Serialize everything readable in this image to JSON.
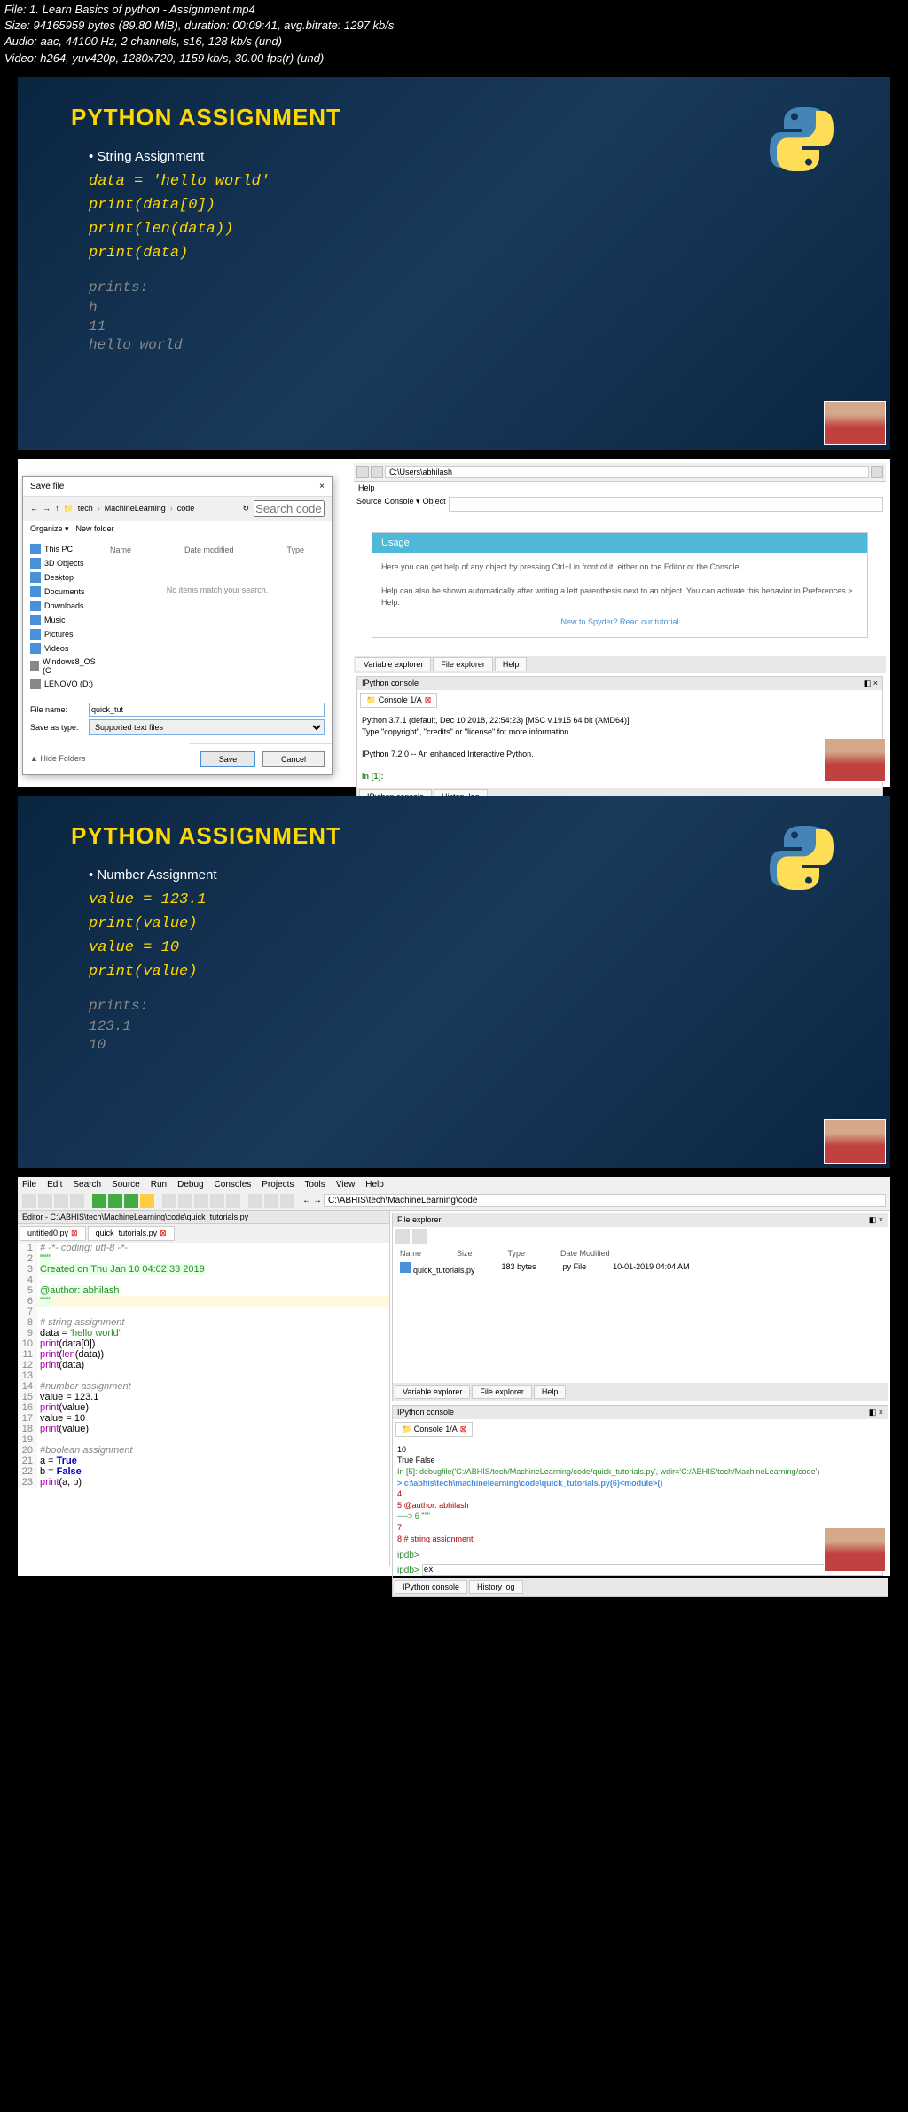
{
  "header": {
    "file": "File: 1. Learn Basics of python - Assignment.mp4",
    "size": "Size: 94165959 bytes (89.80 MiB), duration: 00:09:41, avg.bitrate: 1297 kb/s",
    "audio": "Audio: aac, 44100 Hz, 2 channels, s16, 128 kb/s (und)",
    "video": "Video: h264, yuv420p, 1280x720, 1159 kb/s, 30.00 fps(r) (und)"
  },
  "slide1": {
    "title": "PYTHON ASSIGNMENT",
    "subtitle": "String Assignment",
    "code": [
      "data = 'hello world'",
      "print(data[0])",
      "print(len(data))",
      "print(data)"
    ],
    "prints_label": "prints:",
    "output": [
      "h",
      "11",
      "hello world"
    ]
  },
  "dialog": {
    "title": "Save file",
    "path_parts": [
      "tech",
      "MachineLearning",
      "code"
    ],
    "search_placeholder": "Search code",
    "organize": "Organize ▾",
    "new_folder": "New folder",
    "cols": [
      "Name",
      "Date modified",
      "Type"
    ],
    "empty": "No items match your search.",
    "sidebar": [
      "This PC",
      "3D Objects",
      "Desktop",
      "Documents",
      "Downloads",
      "Music",
      "Pictures",
      "Videos",
      "Windows8_OS (C",
      "LENOVO (D:)"
    ],
    "filename_label": "File name:",
    "filename_value": "quick_tut",
    "saveas_label": "Save as type:",
    "saveas_value": "Supported text files",
    "hide_folders": "▲ Hide Folders",
    "save_btn": "Save",
    "cancel_btn": "Cancel"
  },
  "spyder_right": {
    "path": "C:\\Users\\abhilash",
    "help_menu": "Help",
    "source_label": "Source",
    "console_label": "Console ▾",
    "object_label": "Object",
    "usage_title": "Usage",
    "usage_text1": "Here you can get help of any object by pressing Ctrl+I in front of it, either on the Editor or the Console.",
    "usage_text2": "Help can also be shown automatically after writing a left parenthesis next to an object. You can activate this behavior in Preferences > Help.",
    "usage_link": "New to Spyder? Read our tutorial",
    "panel_tabs": [
      "Variable explorer",
      "File explorer",
      "Help"
    ],
    "ipython_title": "IPython console",
    "console_tab": "Console 1/A",
    "python_info": "Python 3.7.1 (default, Dec 10 2018, 22:54:23) [MSC v.1915 64 bit (AMD64)]",
    "type_info": "Type \"copyright\", \"credits\" or \"license\" for more information.",
    "ipython_info": "IPython 7.2.0 -- An enhanced Interactive Python.",
    "prompt": "In [1]:",
    "bottom_tabs": [
      "IPython console",
      "History log"
    ]
  },
  "slide2": {
    "title": "PYTHON ASSIGNMENT",
    "subtitle": "Number Assignment",
    "code": [
      "value = 123.1",
      "print(value)",
      "value = 10",
      "print(value)"
    ],
    "prints_label": "prints:",
    "output": [
      "123.1",
      "10"
    ]
  },
  "spyder_full": {
    "menus": [
      "File",
      "Edit",
      "Search",
      "Source",
      "Run",
      "Debug",
      "Consoles",
      "Projects",
      "Tools",
      "View",
      "Help"
    ],
    "path": "C:\\ABHIS\\tech\\MachineLearning\\code",
    "editor_title": "Editor - C:\\ABHIS\\tech\\MachineLearning\\code\\quick_tutorials.py",
    "tabs": [
      "untitled0.py",
      "quick_tutorials.py"
    ],
    "code_lines": [
      {
        "n": 1,
        "t": "# -*- coding: utf-8 -*-",
        "cls": "comment"
      },
      {
        "n": 2,
        "t": "\"\"\"",
        "cls": "docstring"
      },
      {
        "n": 3,
        "t": "Created on Thu Jan 10 04:02:33 2019",
        "cls": "docstring"
      },
      {
        "n": 4,
        "t": "",
        "cls": "docstring"
      },
      {
        "n": 5,
        "t": "@author: abhilash",
        "cls": "docstring"
      },
      {
        "n": 6,
        "t": "\"\"\"",
        "cls": "docstring active"
      },
      {
        "n": 7,
        "t": "",
        "cls": ""
      },
      {
        "n": 8,
        "t": "# string assignment",
        "cls": "comment"
      },
      {
        "n": 9,
        "t": "data = 'hello world'",
        "cls": "mixed"
      },
      {
        "n": 10,
        "t": "print(data[0])",
        "cls": "mixed"
      },
      {
        "n": 11,
        "t": "print(len(data))",
        "cls": "mixed"
      },
      {
        "n": 12,
        "t": "print(data)",
        "cls": "mixed"
      },
      {
        "n": 13,
        "t": "",
        "cls": ""
      },
      {
        "n": 14,
        "t": "#number assignment",
        "cls": "comment"
      },
      {
        "n": 15,
        "t": "value = 123.1",
        "cls": "mixed"
      },
      {
        "n": 16,
        "t": "print(value)",
        "cls": "mixed"
      },
      {
        "n": 17,
        "t": "value = 10",
        "cls": "mixed"
      },
      {
        "n": 18,
        "t": "print(value)",
        "cls": "mixed"
      },
      {
        "n": 19,
        "t": "",
        "cls": ""
      },
      {
        "n": 20,
        "t": "#boolean assignment",
        "cls": "comment"
      },
      {
        "n": 21,
        "t": "a = True",
        "cls": "mixed"
      },
      {
        "n": 22,
        "t": "b = False",
        "cls": "mixed"
      },
      {
        "n": 23,
        "t": "print(a, b)",
        "cls": "mixed"
      }
    ],
    "fe_title": "File explorer",
    "fe_cols": [
      "Name",
      "Size",
      "Type",
      "Date Modified"
    ],
    "fe_row": {
      "name": "quick_tutorials.py",
      "size": "183 bytes",
      "type": "py File",
      "date": "10-01-2019 04:04 AM"
    },
    "panel_tabs": [
      "Variable explorer",
      "File explorer",
      "Help"
    ],
    "ipython_title": "IPython console",
    "console_tab": "Console 1/A",
    "ipy_lines": [
      {
        "t": "10",
        "cls": ""
      },
      {
        "t": "True False",
        "cls": ""
      },
      {
        "t": "",
        "cls": ""
      },
      {
        "t": "In [5]: debugfile('C:/ABHIS/tech/MachineLearning/code/quick_tutorials.py', wdir='C:/ABHIS/tech/MachineLearning/code')",
        "cls": "green"
      },
      {
        "t": "> c:\\abhis\\tech\\machinelearning\\code\\quick_tutorials.py(6)<module>()",
        "cls": "blue"
      },
      {
        "t": "      4",
        "cls": "red"
      },
      {
        "t": "      5 @author: abhilash",
        "cls": "red"
      },
      {
        "t": "----> 6 \"\"\"",
        "cls": "green"
      },
      {
        "t": "      7",
        "cls": "red"
      },
      {
        "t": "      8 # string assignment",
        "cls": "red"
      },
      {
        "t": "",
        "cls": ""
      }
    ],
    "ipdb_prompt": "ipdb>",
    "ipdb_input": "ex",
    "bottom_tabs": [
      "IPython console",
      "History log"
    ]
  }
}
